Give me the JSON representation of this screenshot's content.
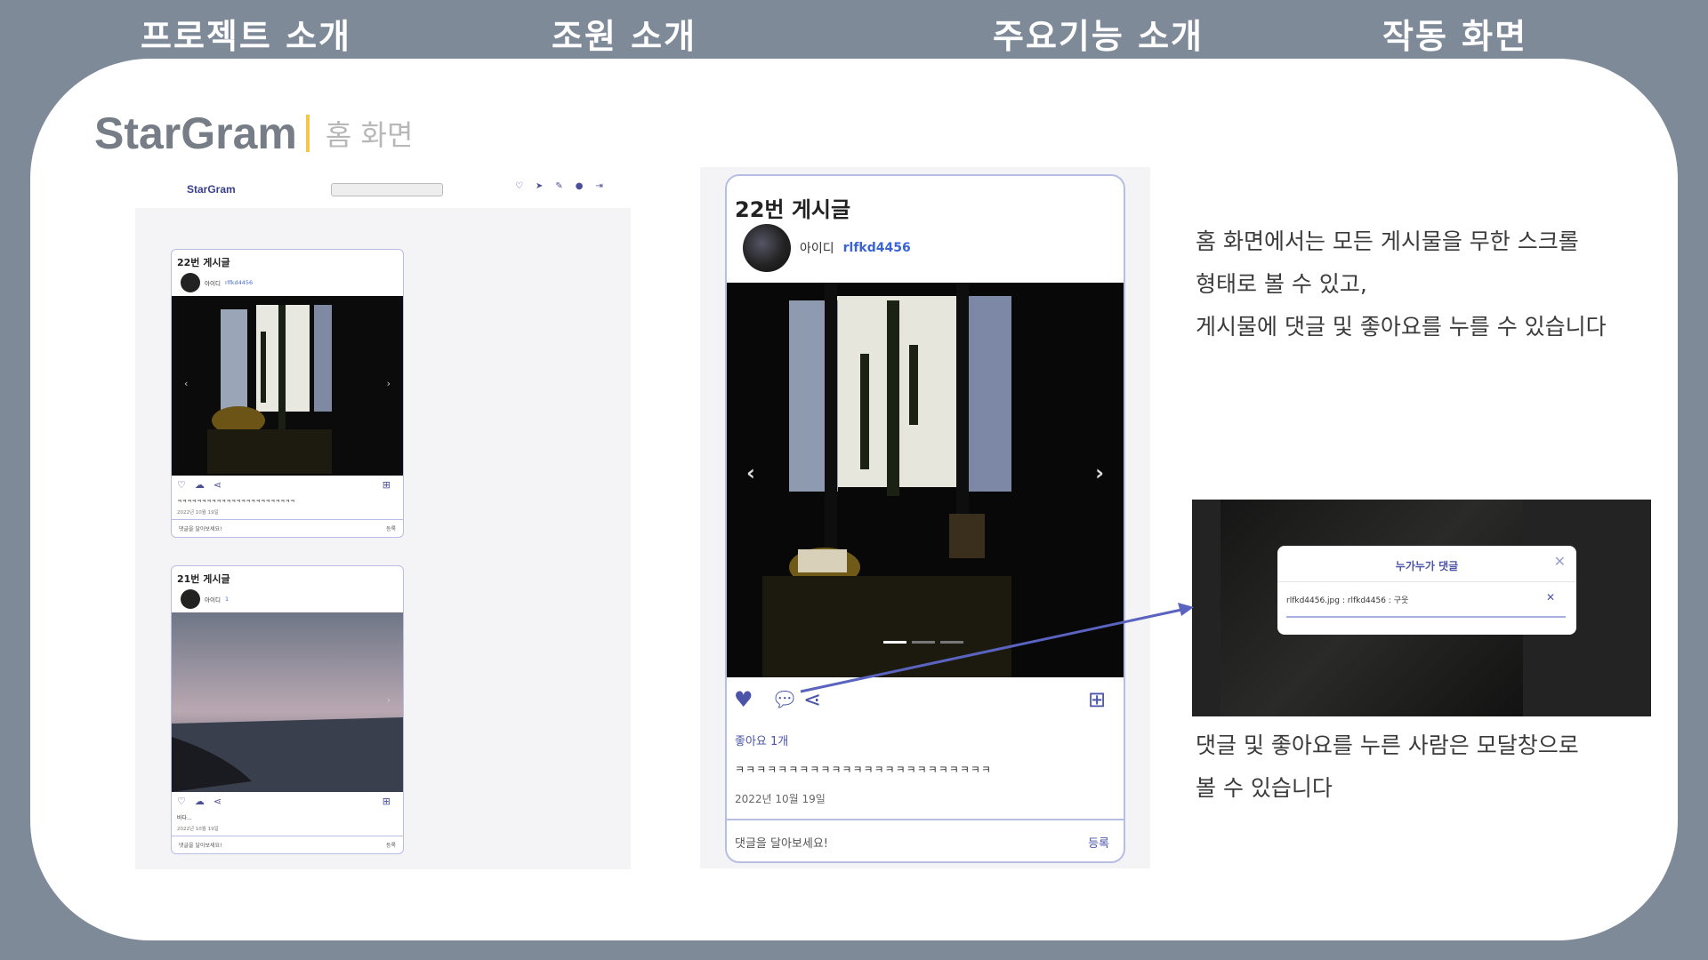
{
  "nav": {
    "items": [
      "프로젝트 소개",
      "조원 소개",
      "주요기능 소개",
      "작동 화면"
    ]
  },
  "brand": {
    "logo": "StarGram",
    "subtitle": "홈 화면"
  },
  "feed": {
    "app_logo": "StarGram",
    "header_icons": [
      "heart-icon",
      "send-icon",
      "pencil-icon",
      "profile-icon",
      "logout-icon"
    ],
    "posts": [
      {
        "title": "22번 게시글",
        "author_label": "아이디",
        "author_id": "rlfkd4456",
        "text": "ㅋㅋㅋㅋㅋㅋㅋㅋㅋㅋㅋㅋㅋㅋㅋㅋㅋㅋㅋㅋㅋㅋㅋㅋ",
        "date": "2022년 10월 19일",
        "comment_placeholder": "댓글을 달아보세요!",
        "register": "등록"
      },
      {
        "title": "21번 게시글",
        "author_label": "아이디",
        "author_id": "1",
        "text": "바다...",
        "date": "2022년 10월 19일",
        "comment_placeholder": "댓글을 달아보세요!",
        "register": "등록"
      }
    ]
  },
  "detail": {
    "title": "22번 게시글",
    "author_label": "아이디",
    "author_id": "rlfkd4456",
    "likes": "좋아요 1개",
    "text": "ㅋㅋㅋㅋㅋㅋㅋㅋㅋㅋㅋㅋㅋㅋㅋㅋㅋㅋㅋㅋㅋㅋㅋㅋ",
    "date": "2022년 10월 19일",
    "comment_placeholder": "댓글을 달아보세요!",
    "register": "등록"
  },
  "description1": [
    "홈 화면에서는 모든 게시물을 무한 스크롤",
    "형태로 볼 수 있고,",
    "게시물에 댓글 및 좋아요를 누를 수 있습니다"
  ],
  "modal": {
    "title": "누가누가 댓글",
    "row": "rlfkd4456.jpg : rlfkd4456 : 구웃"
  },
  "description2": [
    "댓글 및 좋아요를 누른 사람은 모달창으로",
    "볼 수 있습니다"
  ],
  "colors": {
    "accent": "#4b54a8",
    "link": "#3a64d4",
    "nav_bg": "#7f8a99"
  }
}
